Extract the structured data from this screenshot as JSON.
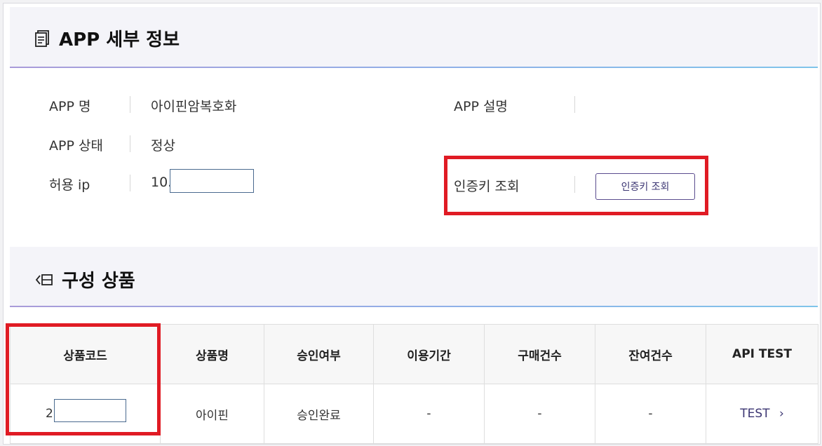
{
  "app_detail": {
    "title": "APP 세부 정보",
    "fields": {
      "app_name_label": "APP 명",
      "app_name_value": "아이핀암복호화",
      "app_desc_label": "APP 설명",
      "app_desc_value": "",
      "app_status_label": "APP 상태",
      "app_status_value": "정상",
      "allowed_ip_label": "허용 ip",
      "allowed_ip_value": "10.",
      "auth_key_label": "인증키 조회",
      "auth_key_button": "인증키 조회"
    }
  },
  "products": {
    "title": "구성 상품",
    "columns": [
      "상품코드",
      "상품명",
      "승인여부",
      "이용기간",
      "구매건수",
      "잔여건수",
      "API TEST"
    ],
    "rows": [
      {
        "code": "2",
        "name": "아이핀",
        "approval": "승인완료",
        "period": "-",
        "purchase_count": "-",
        "remaining_count": "-",
        "api_test": "TEST",
        "api_test_arrow": "›"
      }
    ]
  },
  "colors": {
    "highlight": "#e01b24",
    "accent": "#3b3572"
  },
  "icons": {
    "detail_icon": "document-icon",
    "products_icon": "list-icon"
  }
}
